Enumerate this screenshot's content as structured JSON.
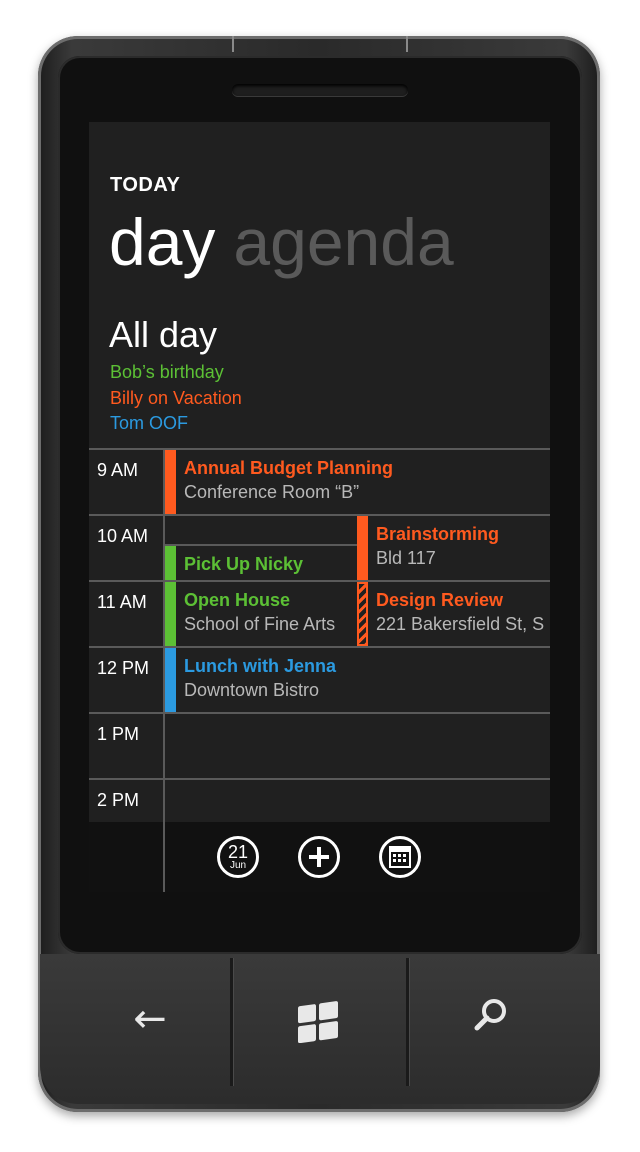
{
  "header": {
    "section": "TODAY"
  },
  "pivot": {
    "active": "day",
    "inactive": "agenda"
  },
  "all_day": {
    "title": "All day",
    "items": [
      {
        "label": "Bob’s birthday",
        "color": "#5cc035"
      },
      {
        "label": "Billy on Vacation",
        "color": "#ff5a1f"
      },
      {
        "label": "Tom OOF",
        "color": "#2b9ae0"
      }
    ]
  },
  "times": [
    "9 AM",
    "10 AM",
    "11 AM",
    "12 PM",
    "1 PM",
    "2 PM"
  ],
  "events": [
    {
      "title": "Annual Budget Planning",
      "location": "Conference Room “B”",
      "color": "#ff5a1f"
    },
    {
      "title": "Brainstorming",
      "location": "Bld 117",
      "color": "#ff5a1f"
    },
    {
      "title": "Pick Up Nicky",
      "location": "",
      "color": "#5cc035"
    },
    {
      "title": "Open House",
      "location": "School of Fine Arts",
      "color": "#5cc035"
    },
    {
      "title": "Design Review",
      "location": "221 Bakersfield St, S",
      "color": "#ff5a1f",
      "tentative": true
    },
    {
      "title": "Lunch with Jenna",
      "location": "Downtown Bistro",
      "color": "#2b9ae0"
    }
  ],
  "appbar": {
    "today_day": "21",
    "today_month": "Jun"
  },
  "hardware": {
    "back": "←",
    "search": "⚲"
  }
}
